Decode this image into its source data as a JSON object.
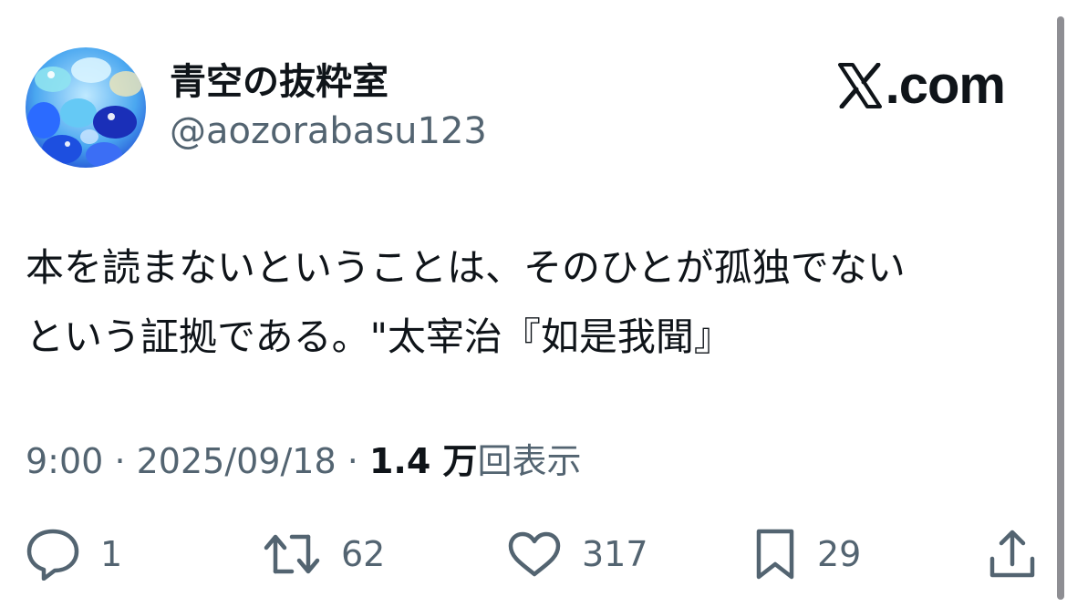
{
  "colors": {
    "text_primary": "#0f1419",
    "text_secondary": "#536471",
    "background": "#ffffff"
  },
  "header": {
    "avatar_icon": "profile-avatar-image",
    "display_name": "青空の抜粋室",
    "handle": "@aozorabasu123",
    "brand_icon": "x-logo-icon",
    "brand_text": ".com"
  },
  "tweet": {
    "lines": [
      "本を読まないということは、そのひとが孤独でない",
      "という証拠である。\"太宰治『如是我聞』"
    ]
  },
  "meta": {
    "time": "9:00",
    "separator": "·",
    "date": "2025/09/18",
    "views_count": "1.4 万",
    "views_label": "回表示"
  },
  "actions": {
    "reply": {
      "icon": "reply-icon",
      "count": "1"
    },
    "retweet": {
      "icon": "retweet-icon",
      "count": "62"
    },
    "like": {
      "icon": "heart-icon",
      "count": "317"
    },
    "bookmark": {
      "icon": "bookmark-icon",
      "count": "29"
    },
    "share": {
      "icon": "share-icon"
    }
  }
}
